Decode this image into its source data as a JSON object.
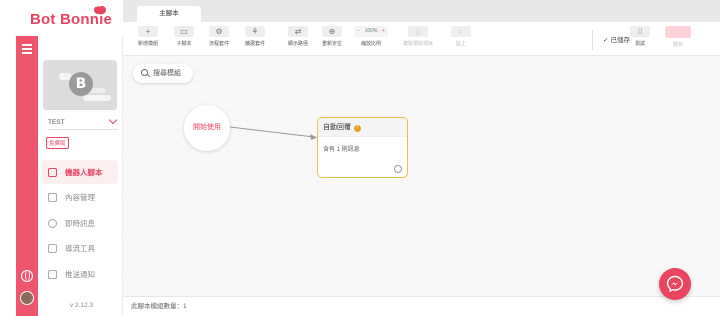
{
  "brand": {
    "name": "Bot Bonnie",
    "accent": "#e94560"
  },
  "bot": {
    "avatar_letter": "B",
    "name": "TEST",
    "plan": "免費版"
  },
  "nav": {
    "items": [
      {
        "label": "機器人腳本",
        "icon": "robot-script-icon",
        "active": true
      },
      {
        "label": "內容管理",
        "icon": "content-icon",
        "active": false
      },
      {
        "label": "即時訊息",
        "icon": "chat-icon",
        "active": false
      },
      {
        "label": "導流工具",
        "icon": "magnet-icon",
        "active": false
      },
      {
        "label": "推送通知",
        "icon": "megaphone-icon",
        "active": false
      }
    ]
  },
  "version": "v 2.12.3",
  "tabs": [
    {
      "label": "主腳本"
    }
  ],
  "toolbar": {
    "tools": [
      {
        "label": "新增模組",
        "glyph": "+",
        "icon": "plus-icon",
        "disabled": false
      },
      {
        "label": "子腳本",
        "glyph": "▭",
        "icon": "folder-icon",
        "disabled": false
      },
      {
        "label": "流程套件",
        "glyph": "⚙",
        "icon": "gear-icon",
        "disabled": false
      },
      {
        "label": "擴展套件",
        "glyph": "⚘",
        "icon": "extension-icon",
        "disabled": false
      },
      {
        "label": "顯示路徑",
        "glyph": "⇄",
        "icon": "path-icon",
        "disabled": false
      },
      {
        "label": "重新定位",
        "glyph": "⊕",
        "icon": "locate-icon",
        "disabled": false
      },
      {
        "label": "縮放比例",
        "glyph": "",
        "icon": "zoom-icon",
        "disabled": false
      },
      {
        "label": "複製選取項目",
        "glyph": "▯",
        "icon": "copy-icon",
        "disabled": true
      },
      {
        "label": "貼上",
        "glyph": "⌕",
        "icon": "paste-icon",
        "disabled": true
      }
    ],
    "zoom": {
      "minus": "−",
      "value": "100%",
      "plus": "+"
    },
    "saved": "已儲存",
    "test_label": "測試",
    "publish_label": "發布"
  },
  "canvas": {
    "search_placeholder": "搜尋模組",
    "start_node": "開始使用",
    "reply_node": {
      "title": "自動回覆",
      "body": "含有 1 則訊息"
    }
  },
  "status": {
    "module_count": "此腳本模組數量：1"
  }
}
